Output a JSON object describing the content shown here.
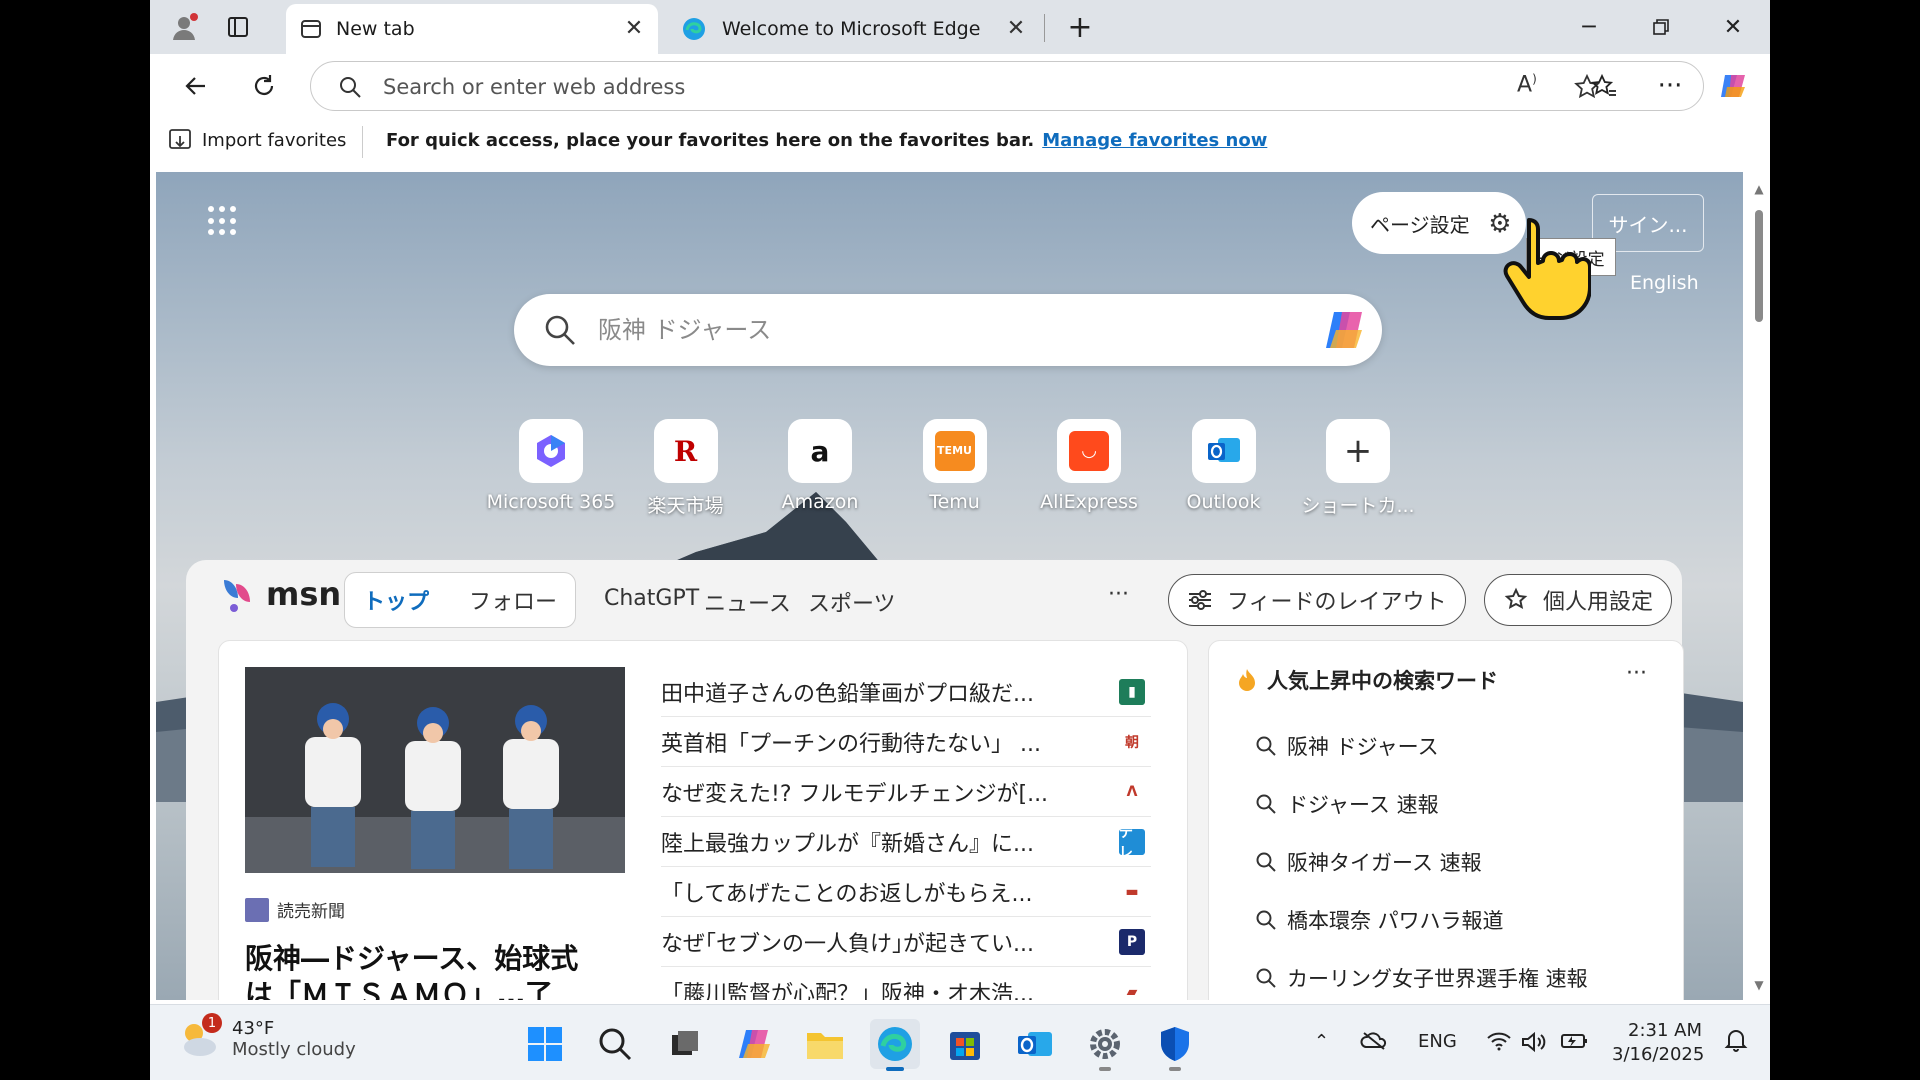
{
  "browser": {
    "tabs": [
      {
        "label": "New tab",
        "active": true
      },
      {
        "label": "Welcome to Microsoft Edge",
        "active": false
      }
    ],
    "address": {
      "placeholder": "Search or enter web address",
      "value": ""
    },
    "favorites_bar": {
      "import_label": "Import favorites",
      "hint": "For quick access, place your favorites here on the favorites bar.",
      "manage_link": "Manage favorites now"
    }
  },
  "newtab": {
    "page_settings_label": "ページ設定",
    "page_settings_tooltip": "ージ設定",
    "signin_label": "サイン...",
    "language_link": "English",
    "search": {
      "placeholder": "阪神 ドジャース"
    },
    "shortcuts": [
      {
        "label": "Microsoft 365",
        "icon": "m365-icon"
      },
      {
        "label": "楽天市場",
        "icon": "rakuten-icon"
      },
      {
        "label": "Amazon",
        "icon": "amazon-icon"
      },
      {
        "label": "Temu",
        "icon": "temu-icon"
      },
      {
        "label": "AliExpress",
        "icon": "aliexpress-icon"
      },
      {
        "label": "Outlook",
        "icon": "outlook-icon"
      },
      {
        "label": "ショートカ...",
        "icon": "plus-icon"
      }
    ]
  },
  "feed": {
    "brand": "msn",
    "pill_tabs": [
      "トップ",
      "フォロー"
    ],
    "nav": [
      "ChatGPT",
      "ニュース",
      "スポーツ"
    ],
    "more": "···",
    "layout_button": "フィードのレイアウト",
    "personalize_button": "個人用設定",
    "hero": {
      "source": "読売新聞",
      "title_line1": "阪神―ドジャース、始球式",
      "title_line2": "は「ＭＩＳＡＭＯ」…了"
    },
    "headlines": [
      {
        "title": "田中道子さんの色鉛筆画がプロ級だ...",
        "src_color": "#1e7d5a",
        "src_text": "▮"
      },
      {
        "title": "英首相「プーチンの行動待たない」 ...",
        "src_color": "#ffffff",
        "src_text": "朝"
      },
      {
        "title": "なぜ変えた!? フルモデルチェンジが[...",
        "src_color": "#ffffff",
        "src_text": "ᐱ"
      },
      {
        "title": "陸上最強カップルが『新婚さん』に...",
        "src_color": "#1f8dd6",
        "src_text": "テレ"
      },
      {
        "title": "「してあげたことのお返しがもらえ...",
        "src_color": "#ffffff",
        "src_text": "▬"
      },
      {
        "title": "なぜ｢セブンの一人負け｣が起きてい...",
        "src_color": "#1b2a6b",
        "src_text": "P"
      },
      {
        "title": "「藤川監督が心配？」阪神・オ木浩...",
        "src_color": "#ffffff",
        "src_text": "▰"
      }
    ],
    "trending": {
      "title": "人気上昇中の検索ワード",
      "more": "···",
      "items": [
        "阪神 ドジャース",
        "ドジャース 速報",
        "阪神タイガース 速報",
        "橋本環奈 パワハラ報道",
        "カーリング女子世界選手権 速報"
      ]
    }
  },
  "taskbar": {
    "weather_temp": "43°F",
    "weather_cond": "Mostly cloudy",
    "weather_badge": "1",
    "lang": "ENG",
    "time": "2:31 AM",
    "date": "3/16/2025"
  }
}
